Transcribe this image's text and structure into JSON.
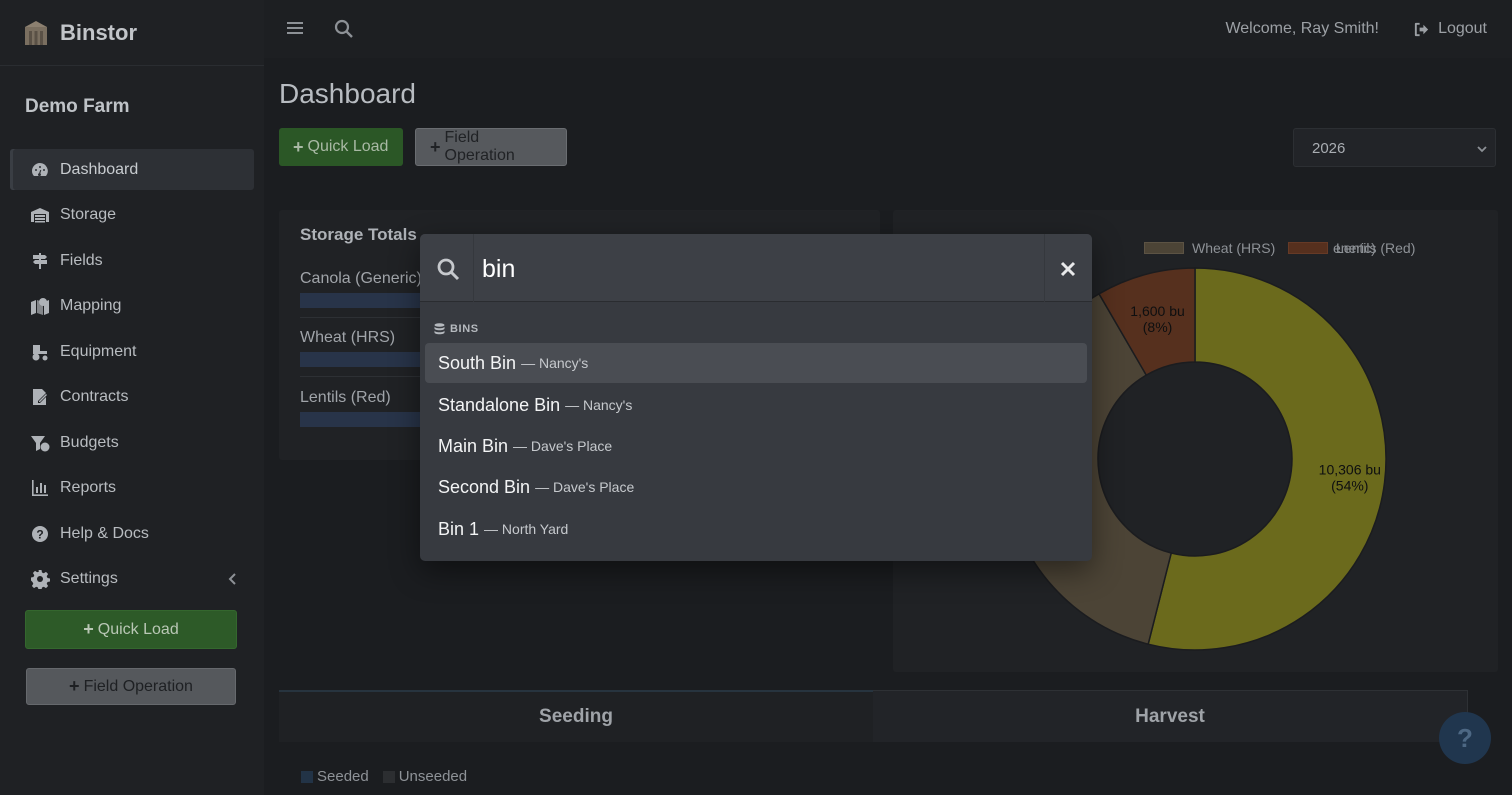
{
  "brand": {
    "name": "Binstor"
  },
  "farm": {
    "name": "Demo Farm"
  },
  "nav": [
    {
      "label": "Dashboard",
      "icon": "gauge-icon"
    },
    {
      "label": "Storage",
      "icon": "warehouse-icon"
    },
    {
      "label": "Fields",
      "icon": "signpost-icon"
    },
    {
      "label": "Mapping",
      "icon": "map-marker-icon"
    },
    {
      "label": "Equipment",
      "icon": "tractor-icon"
    },
    {
      "label": "Contracts",
      "icon": "contract-icon"
    },
    {
      "label": "Budgets",
      "icon": "coins-icon"
    },
    {
      "label": "Reports",
      "icon": "bar-chart-icon"
    },
    {
      "label": "Help & Docs",
      "icon": "question-circle-icon"
    },
    {
      "label": "Settings",
      "icon": "gear-icon"
    }
  ],
  "sidebar_buttons": {
    "quick_load": "Quick Load",
    "field_operation": "Field Operation"
  },
  "header": {
    "welcome": "Welcome, Ray Smith!",
    "logout": "Logout"
  },
  "page": {
    "title": "Dashboard",
    "quick_load": "Quick Load",
    "field_operation": "Field Operation",
    "year": "2026"
  },
  "storage_totals": {
    "title": "Storage Totals",
    "crops": [
      {
        "label": "Canola (Generic)"
      },
      {
        "label": "Wheat (HRS)"
      },
      {
        "label": "Lentils (Red)"
      }
    ]
  },
  "chart_data": {
    "type": "pie",
    "legend": [
      "Canola (Generic)",
      "Wheat (HRS)",
      "Lentils (Red)"
    ],
    "legend_visible": [
      "eneric)",
      "Wheat (HRS)",
      "Lentils (Red)"
    ],
    "slices": [
      {
        "label": "Canola (Generic)",
        "value": 10306,
        "percent": 54,
        "text_line1": "10,306 bu",
        "text_line2": "(54%)",
        "color": "#6b6a1c"
      },
      {
        "label": "Wheat (HRS)",
        "value": 7200,
        "percent": 38,
        "text_line1": "",
        "text_line2": "",
        "color": "#4c4436"
      },
      {
        "label": "Lentils (Red)",
        "value": 1600,
        "percent": 8,
        "text_line1": "1,600 bu",
        "text_line2": "(8%)",
        "color": "#56301e"
      }
    ],
    "donut": true
  },
  "tabs": {
    "seeding": "Seeding",
    "harvest": "Harvest"
  },
  "seed_legend": {
    "seeded": "Seeded",
    "unseeded": "Unseeded"
  },
  "help_fab": "?",
  "search": {
    "query": "bin",
    "section": "BINS",
    "results": [
      {
        "name": "South Bin",
        "sub": "— Nancy's"
      },
      {
        "name": "Standalone Bin",
        "sub": "— Nancy's"
      },
      {
        "name": "Main Bin",
        "sub": "— Dave's Place"
      },
      {
        "name": "Second Bin",
        "sub": "— Dave's Place"
      },
      {
        "name": "Bin 1",
        "sub": "— North Yard"
      }
    ]
  },
  "colors": {
    "accent_green": "#2b5726",
    "chart_canola": "#6b6a1c",
    "chart_wheat": "#4c4436",
    "chart_lentils": "#56301e",
    "modal_bg": "#373a40",
    "selected_row": "#4a4d53"
  }
}
